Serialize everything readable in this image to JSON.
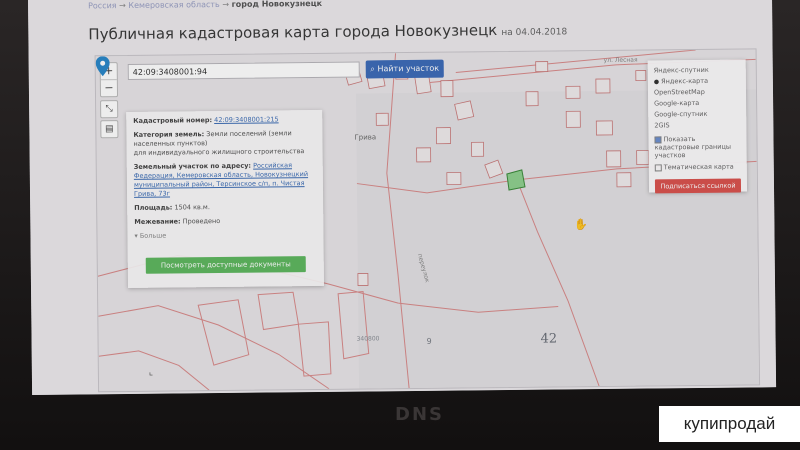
{
  "breadcrumbs": {
    "item1": "Россия",
    "arrow1": " → ",
    "item2": "Кемеровская область",
    "arrow2": " → ",
    "current": "город Новокузнецк"
  },
  "page": {
    "title": "Публичная кадастровая карта города Новокузнецк",
    "date": "на 04.04.2018"
  },
  "map_controls": {
    "zoom_in": "+",
    "zoom_out": "−"
  },
  "search": {
    "value": "42:09:3408001:94",
    "button": "Найти участок"
  },
  "info_panel": {
    "cadastral_label": "Кадастровый номер:",
    "cadastral_value": "42:09:3408001:215",
    "category_label": "Категория земель:",
    "category_value": "Земли поселений (земли населенных пунктов)",
    "use_value": "для индивидуального жилищного строительства",
    "address_label": "Земельный участок по адресу:",
    "address_value": "Российская Федерация, Кемеровская область, Новокузнецкий муниципальный район, Терсинское с/п, п. Чистая Грива, 73г",
    "area_label": "Площадь:",
    "area_value": "1504 кв.м.",
    "survey_label": "Межевание:",
    "survey_value": "Проведено",
    "more": "Больше",
    "docs_button": "Посмотреть доступные документы"
  },
  "layers_panel": {
    "options": [
      "Яндекс-спутник",
      "Яндекс-карта",
      "OpenStreetMap",
      "Google-карта",
      "Google-спутник",
      "2GIS"
    ],
    "selected_index": 1,
    "check_boundaries": "Показать кадастровые границы участков",
    "check_thematic": "Тематическая карта",
    "button": "Подписаться ссылкой"
  },
  "map_labels": {
    "block_42": "42",
    "block_9": "9",
    "plot_3": "340800",
    "road": "переулок",
    "street": "ул. Лесная",
    "place": "Грива"
  },
  "device": {
    "brand": "DNS"
  },
  "watermark": "купипродай",
  "colors": {
    "accent_blue": "#3d6bb8",
    "docs_green": "#5fb760",
    "subscribe_red": "#d9534f",
    "parcel_lines": "#d88a8a"
  }
}
